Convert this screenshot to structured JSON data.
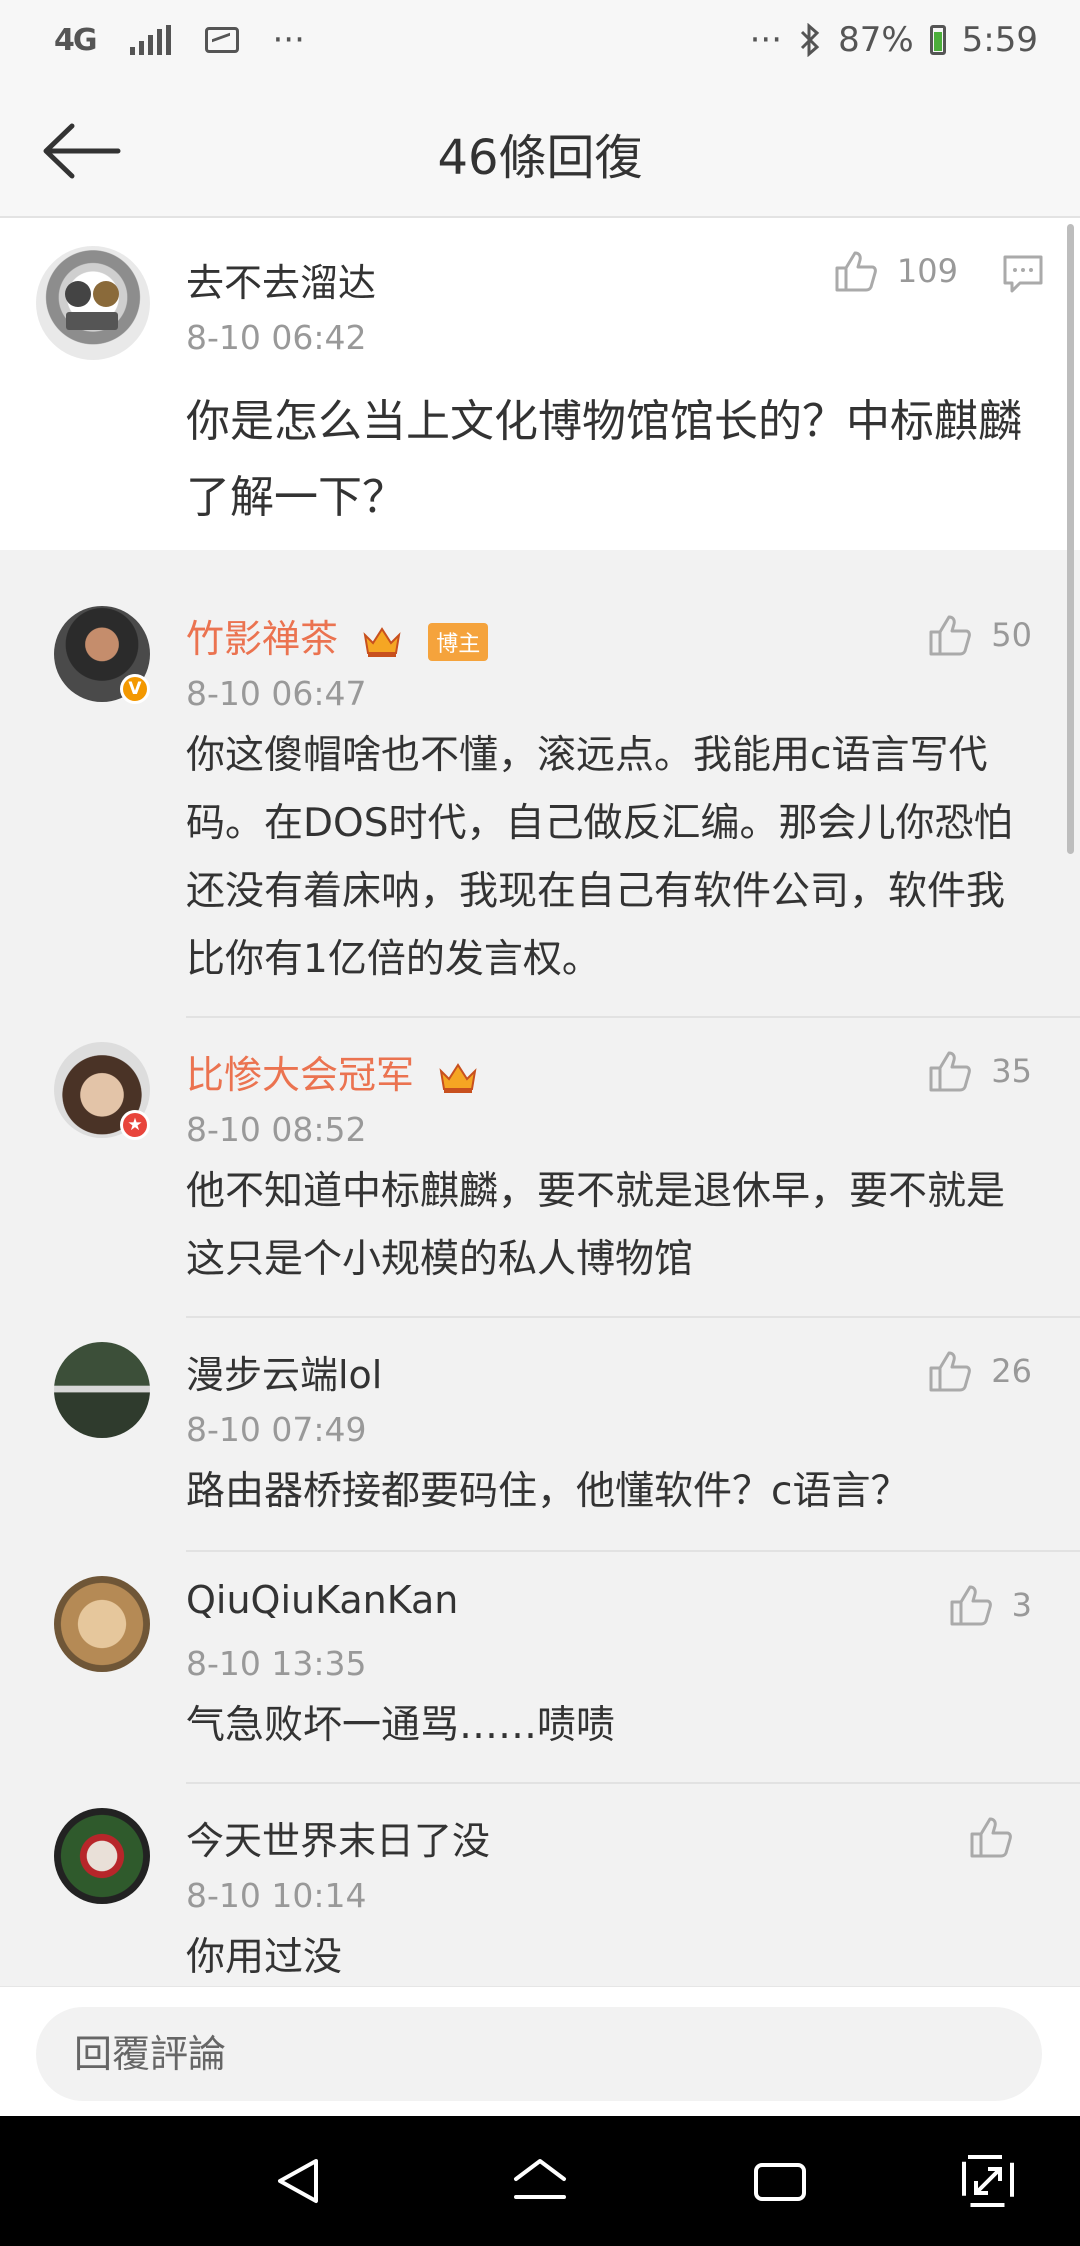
{
  "status_bar": {
    "network": "4G",
    "more_left": "···",
    "more_right": "···",
    "battery": "87%",
    "time": "5:59"
  },
  "header": {
    "title": "46條回復"
  },
  "comments": [
    {
      "user": "去不去溜达",
      "time": "8-10 06:42",
      "text": "你是怎么当上文化博物馆馆长的？中标麒麟了解一下？",
      "likes": "109"
    },
    {
      "user": "竹影禅茶",
      "badge": "博主",
      "time": "8-10 06:47",
      "text": "你这傻帽啥也不懂，滚远点。我能用c语言写代码。在DOS时代，自己做反汇编。那会儿你恐怕还没有着床呐，我现在自己有软件公司，软件我比你有1亿倍的发言权。",
      "likes": "50"
    },
    {
      "user": "比惨大会冠军",
      "time": "8-10 08:52",
      "text": "他不知道中标麒麟，要不就是退休早，要不就是这只是个小规模的私人博物馆",
      "likes": "35"
    },
    {
      "user": "漫步云端lol",
      "time": "8-10 07:49",
      "text": "路由器桥接都要码住，他懂软件？c语言？",
      "likes": "26"
    },
    {
      "user": "QiuQiuKanKan",
      "time": "8-10 13:35",
      "text": "气急败坏一通骂……啧啧",
      "likes": "3"
    },
    {
      "user": "今天世界末日了没",
      "time": "8-10 10:14",
      "text": "你用过没",
      "likes": ""
    }
  ],
  "reply_bar": {
    "placeholder": "回覆評論"
  },
  "colors": {
    "vip_name": "#eb7350",
    "crown": "#f5a623",
    "badge": "#f5a33c",
    "battery_green": "#4cae3b"
  },
  "icons": [
    "back-arrow-icon",
    "thumb-up-icon",
    "comment-icon",
    "crown-icon",
    "nav-back-icon",
    "nav-home-icon",
    "nav-recents-icon",
    "nav-expand-icon"
  ]
}
